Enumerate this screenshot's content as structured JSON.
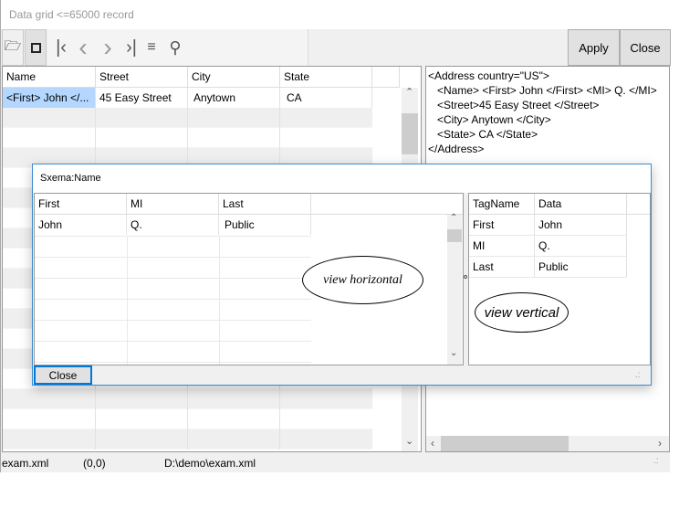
{
  "window": {
    "title": "Data grid <=65000 record"
  },
  "toolbar": {
    "icons": [
      "folder-open-icon",
      "save-icon",
      "first-record-icon",
      "previous-icon",
      "next-icon",
      "last-record-icon",
      "wrap-icon",
      "search-icon"
    ],
    "apply_label": "Apply",
    "close_label": "Close"
  },
  "main_grid": {
    "columns": [
      "Name",
      "Street",
      "City",
      "State"
    ],
    "rows": [
      [
        "<First> John </...",
        "45 Easy Street",
        "Anytown",
        "CA"
      ]
    ]
  },
  "xml_view": {
    "lines": [
      "<Address country=\"US\">",
      "   <Name> <First> John </First> <MI> Q. </MI>",
      "   <Street>45 Easy Street </Street>",
      "   <City> Anytown </City>",
      "   <State> CA </State>",
      "</Address>"
    ]
  },
  "status": {
    "file": "exam.xml",
    "position": "(0,0)",
    "path": "D:\\demo\\exam.xml"
  },
  "dialog": {
    "title": "Sxema:Name",
    "h_columns": [
      "First",
      "MI",
      "Last"
    ],
    "h_rows": [
      [
        "John",
        "Q.",
        "Public"
      ]
    ],
    "v_columns": [
      "TagName",
      "Data"
    ],
    "v_rows": [
      [
        "First",
        "John"
      ],
      [
        "MI",
        "Q."
      ],
      [
        "Last",
        "Public"
      ]
    ],
    "annot_horizontal": "view horizontal",
    "annot_vertical": "view vertical",
    "close_label": "Close"
  },
  "colors": {
    "selection": "#b3d7ff",
    "dialog_border": "#3c8bd1"
  }
}
